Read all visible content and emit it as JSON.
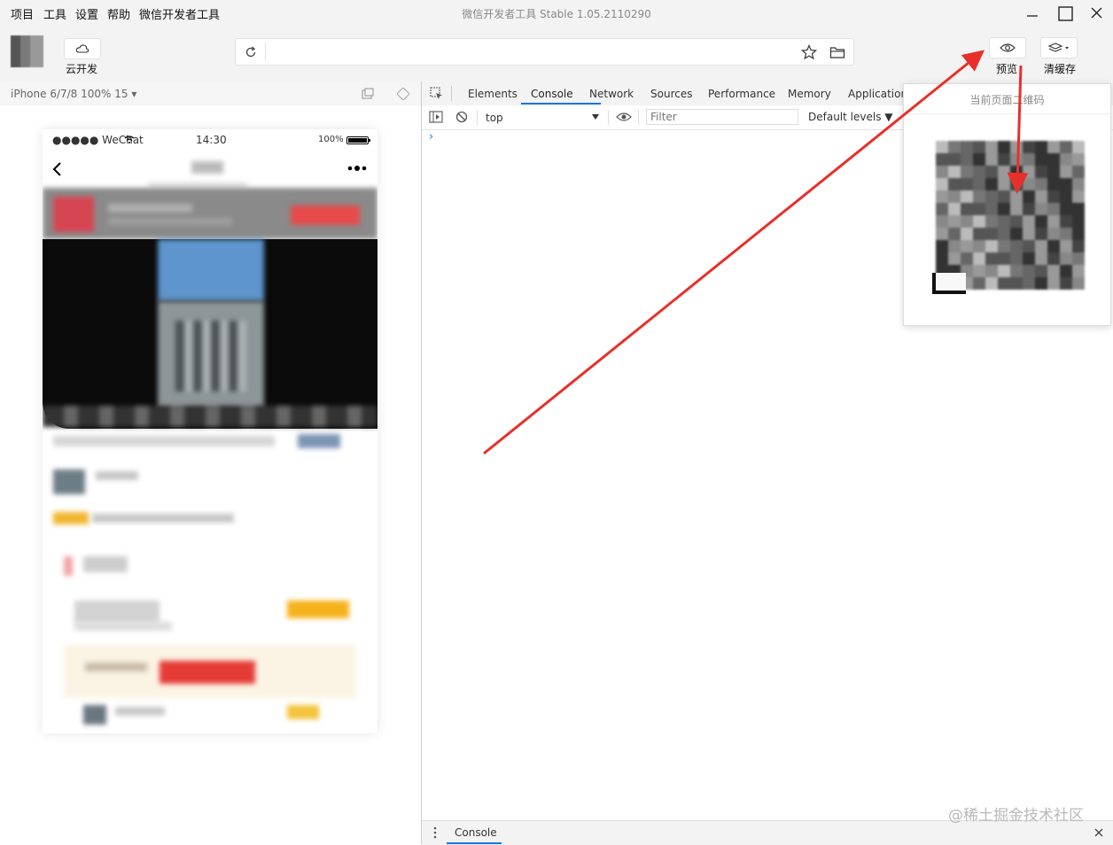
{
  "menu": [
    "项目",
    "工具",
    "设置",
    "帮助",
    "微信开发者工具"
  ],
  "window_title": "微信开发者工具 Stable 1.05.2110290",
  "toolbar": {
    "cloud_label": "云开发",
    "preview_label": "预览",
    "clear_cache_label": "清缓存"
  },
  "simulator": {
    "device": "iPhone 6/7/8 100% 15 ▾",
    "status_carrier": "●●●●● WeChat",
    "status_time": "14:30",
    "status_battery": "100%"
  },
  "devtools": {
    "tabs": [
      "Elements",
      "Console",
      "Network",
      "Sources",
      "Performance",
      "Memory",
      "Application"
    ],
    "active_tab": "Console",
    "context": "top",
    "filter_placeholder": "Filter",
    "levels": "Default levels ▼",
    "prompt": "›"
  },
  "drawer": {
    "tab": "Console"
  },
  "qr_popup": {
    "title": "当前页面二维码"
  },
  "watermark": "@稀土掘金技术社区",
  "colors": {
    "accent": "#1a73e8",
    "arrow": "#e8302a"
  }
}
